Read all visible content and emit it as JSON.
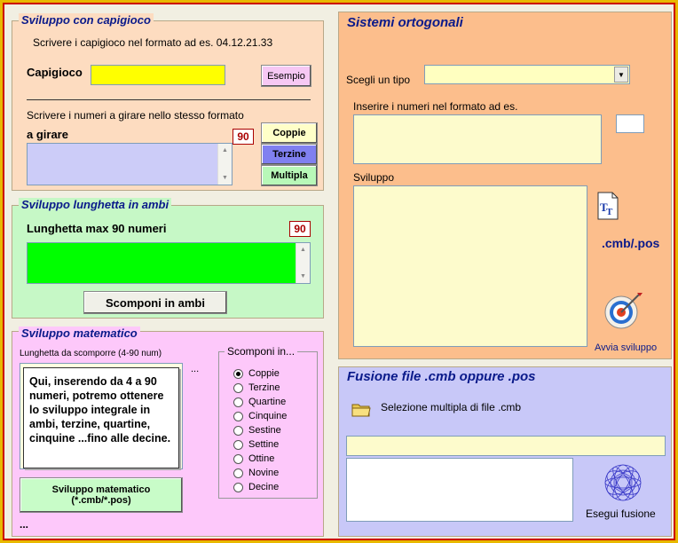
{
  "capigioco": {
    "title": "Sviluppo con capigioco",
    "instruction": "Scrivere i capigioco nel formato ad es. 04.12.21.33",
    "field_label": "Capigioco",
    "example_button": "Esempio",
    "girare_instruction": "Scrivere i numeri a girare nello stesso formato",
    "girare_label": "a girare",
    "count": "90",
    "buttons": {
      "coppie": "Coppie",
      "terzine": "Terzine",
      "multipla": "Multipla"
    }
  },
  "lunghetta": {
    "title": "Sviluppo lunghetta in ambi",
    "label": "Lunghetta max 90 numeri",
    "count": "90",
    "button": "Scomponi in ambi"
  },
  "matematico": {
    "title": "Sviluppo matematico",
    "length_label": "Lunghetta da scomporre (4-90 num)",
    "ellipsis_right": "...",
    "tooltip": "Qui, inserendo da 4 a 90 numeri, potremo ottenere lo sviluppo integrale  in ambi, terzine, quartine, cinquine ...fino alle decine.",
    "button": "Sviluppo matematico\n(*.cmb/*.pos)",
    "ellipsis_bottom": "...",
    "group_title": "Scomponi in...",
    "options": [
      "Coppie",
      "Terzine",
      "Quartine",
      "Cinquine",
      "Sestine",
      "Settine",
      "Ottine",
      "Novine",
      "Decine"
    ],
    "selected": "Coppie"
  },
  "ortogonali": {
    "title": "Sistemi ortogonali",
    "type_label": "Scegli un tipo",
    "type_value": "",
    "numbers_label": "Inserire i numeri nel formato ad es.",
    "sviluppo_label": "Sviluppo",
    "ext_label": ".cmb/.pos",
    "text_icon": "text-file-icon",
    "run_icon": "target-icon",
    "run_label": "Avvia sviluppo"
  },
  "fusione": {
    "title": "Fusione file .cmb oppure .pos",
    "select_label": "Selezione multipla di file .cmb",
    "folder_icon": "folder-icon",
    "run_icon": "spiral-icon",
    "run_label": "Esegui fusione"
  },
  "colors": {
    "capigioco_bg": "#fddcc0",
    "lunghetta_bg": "#c6f8c6",
    "matematico_bg": "#fdc8fa",
    "ortogonali_bg": "#fcbe8c",
    "fusione_bg": "#c8c8f8",
    "title_blue": "#0a1a8a",
    "yellow": "#ffff00",
    "lightyellow": "#fdfbcc",
    "green": "#00ff00"
  }
}
